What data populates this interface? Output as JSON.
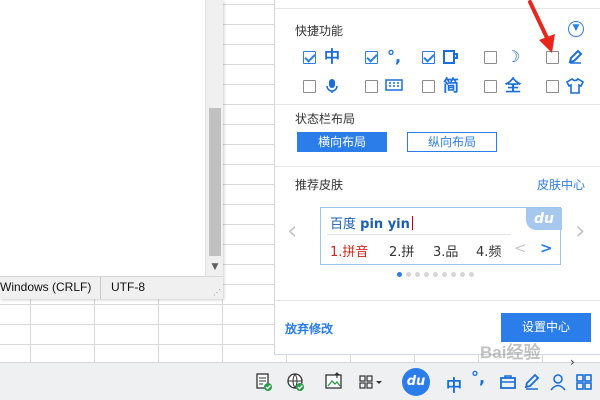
{
  "notepad": {
    "status_eol": "Windows (CRLF)",
    "status_encoding": "UTF-8"
  },
  "panel": {
    "quick_functions_title": "快捷功能",
    "quick_options": [
      {
        "icon": "chinese-mode-icon",
        "glyph": "中",
        "checked": true
      },
      {
        "icon": "chinese-punctuation-icon",
        "glyph": "°,",
        "checked": true
      },
      {
        "icon": "fullwidth-icon",
        "glyph": "",
        "checked": true
      },
      {
        "icon": "moon-icon",
        "glyph": "☽",
        "checked": false
      },
      {
        "icon": "pen-icon",
        "glyph": "",
        "checked": false
      },
      {
        "icon": "microphone-icon",
        "glyph": "",
        "checked": false
      },
      {
        "icon": "keyboard-icon",
        "glyph": "",
        "checked": false
      },
      {
        "icon": "simplified-icon",
        "glyph": "简",
        "checked": false
      },
      {
        "icon": "fullshape-icon",
        "glyph": "全",
        "checked": false
      },
      {
        "icon": "skin-shirt-icon",
        "glyph": "",
        "checked": false
      }
    ],
    "status_layout_title": "状态栏布局",
    "layout_horizontal": "横向布局",
    "layout_vertical": "纵向布局",
    "recommended_skins_title": "推荐皮肤",
    "skin_center_link": "皮肤中心",
    "preview": {
      "input_prefix": "百度",
      "input_pinyin": "pin yin",
      "logo": "du",
      "candidates": [
        "1.拼音",
        "2.拼",
        "3.品",
        "4.频"
      ],
      "prev": "<",
      "next": ">"
    },
    "skin_page_count": 9,
    "skin_page_active": 1,
    "abandon_changes": "放弃修改",
    "settings_center": "设置中心"
  },
  "taskbar": {
    "ime_logo": "du",
    "ime_mode": "中",
    "ime_punct": "°,",
    "expand_glyph": "›"
  },
  "watermark": "Bai经验",
  "colors": {
    "accent": "#2b7de9",
    "candidate_first": "#d0261d",
    "annotation_arrow": "#e8261c"
  }
}
